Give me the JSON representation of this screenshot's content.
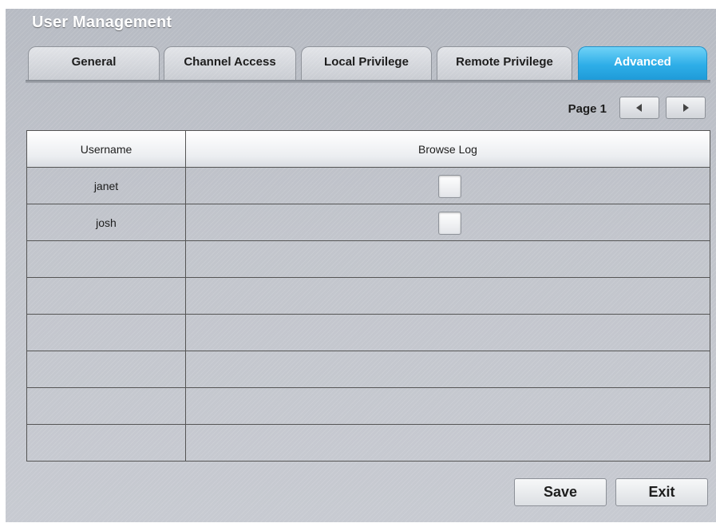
{
  "window": {
    "title": "User Management"
  },
  "tabs": [
    {
      "label": "General",
      "active": false
    },
    {
      "label": "Channel Access",
      "active": false
    },
    {
      "label": "Local Privilege",
      "active": false
    },
    {
      "label": "Remote Privilege",
      "active": false
    },
    {
      "label": "Advanced",
      "active": true
    }
  ],
  "pagination": {
    "label": "Page 1",
    "prev_icon": "triangle-left-icon",
    "next_icon": "triangle-right-icon"
  },
  "table": {
    "headers": {
      "username": "Username",
      "browse_log": "Browse Log"
    },
    "rows": [
      {
        "username": "janet",
        "browse_log": false
      },
      {
        "username": "josh",
        "browse_log": false
      },
      {
        "username": ""
      },
      {
        "username": ""
      },
      {
        "username": ""
      },
      {
        "username": ""
      },
      {
        "username": ""
      },
      {
        "username": ""
      }
    ]
  },
  "actions": {
    "save_label": "Save",
    "exit_label": "Exit"
  },
  "colors": {
    "accent": "#2eaee8",
    "panel": "#c2c5cc",
    "text": "#1d1d1d"
  }
}
